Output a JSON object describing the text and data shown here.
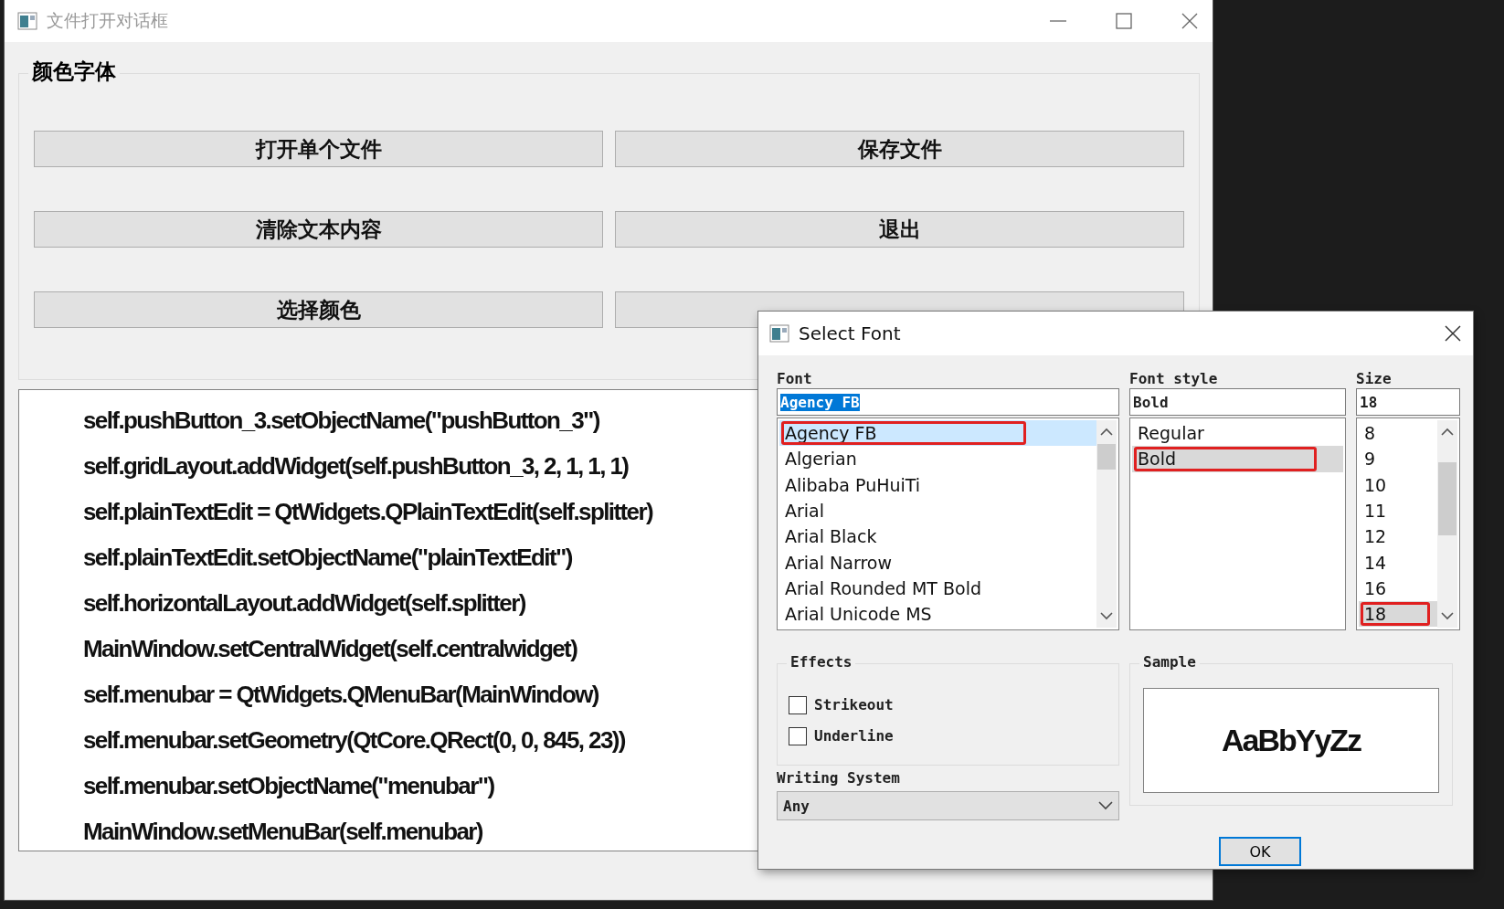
{
  "main_window": {
    "title": "文件打开对话框",
    "group_title": "颜色字体",
    "buttons": [
      {
        "kind": "labeled",
        "label": "打开单个文件"
      },
      {
        "kind": "labeled",
        "label": "保存文件"
      },
      {
        "kind": "labeled",
        "label": "清除文本内容"
      },
      {
        "kind": "labeled",
        "label": "退出"
      },
      {
        "kind": "labeled",
        "label": "选择颜色"
      },
      {
        "kind": "covered"
      }
    ],
    "text_lines": [
      "self.pushButton_3.setObjectName(\"pushButton_3\")",
      "self.gridLayout.addWidget(self.pushButton_3, 2, 1, 1, 1)",
      "self.plainTextEdit = QtWidgets.QPlainTextEdit(self.splitter)",
      "self.plainTextEdit.setObjectName(\"plainTextEdit\")",
      "self.horizontalLayout.addWidget(self.splitter)",
      "MainWindow.setCentralWidget(self.centralwidget)",
      "self.menubar = QtWidgets.QMenuBar(MainWindow)",
      "self.menubar.setGeometry(QtCore.QRect(0, 0, 845, 23))",
      "self.menubar.setObjectName(\"menubar\")",
      "MainWindow.setMenuBar(self.menubar)"
    ]
  },
  "dialog": {
    "title": "Select Font",
    "font": {
      "label": "Font",
      "value": "Agency FB",
      "items": [
        {
          "label": "Agency FB",
          "selected": true,
          "marked": true
        },
        {
          "label": "Algerian",
          "selected": false,
          "marked": false
        },
        {
          "label": "Alibaba PuHuiTi",
          "selected": false,
          "marked": false
        },
        {
          "label": "Arial",
          "selected": false,
          "marked": false
        },
        {
          "label": "Arial Black",
          "selected": false,
          "marked": false
        },
        {
          "label": "Arial Narrow",
          "selected": false,
          "marked": false
        },
        {
          "label": "Arial Rounded MT Bold",
          "selected": false,
          "marked": false
        },
        {
          "label": "Arial Unicode MS",
          "selected": false,
          "marked": false
        }
      ]
    },
    "style": {
      "label": "Font style",
      "value": "Bold",
      "items": [
        {
          "label": "Regular",
          "selected": false,
          "marked": false
        },
        {
          "label": "Bold",
          "selected": true,
          "marked": true
        }
      ]
    },
    "size": {
      "label": "Size",
      "value": "18",
      "items": [
        {
          "label": "8",
          "selected": false,
          "marked": false
        },
        {
          "label": "9",
          "selected": false,
          "marked": false
        },
        {
          "label": "10",
          "selected": false,
          "marked": false
        },
        {
          "label": "11",
          "selected": false,
          "marked": false
        },
        {
          "label": "12",
          "selected": false,
          "marked": false
        },
        {
          "label": "14",
          "selected": false,
          "marked": false
        },
        {
          "label": "16",
          "selected": false,
          "marked": false
        },
        {
          "label": "18",
          "selected": true,
          "marked": true
        }
      ]
    },
    "effects": {
      "title": "Effects",
      "options": [
        {
          "label": "Strikeout",
          "checked": false
        },
        {
          "label": "Underline",
          "checked": false
        }
      ]
    },
    "writing_system": {
      "label": "Writing System",
      "value": "Any"
    },
    "sample": {
      "title": "Sample",
      "text": "AaBbYyZz"
    },
    "ok_button": "OK"
  }
}
